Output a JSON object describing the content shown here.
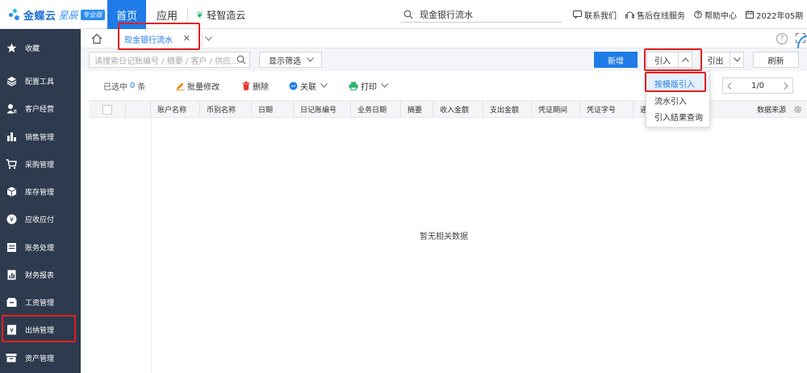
{
  "brand": {
    "name": "金蝶云",
    "sub": "星辰",
    "badge": "专业版",
    "color": "#1f7be8"
  },
  "topnav": {
    "home": "首页",
    "apps": "应用",
    "qz": "轻智造云"
  },
  "global_search": {
    "value": "现金银行流水"
  },
  "top_links": [
    {
      "label": "联系我们",
      "icon": "message-icon"
    },
    {
      "label": "售后在线服务",
      "icon": "headset-icon"
    },
    {
      "label": "帮助中心",
      "icon": "help-icon"
    },
    {
      "label": "2022年05期",
      "icon": "calendar-icon"
    }
  ],
  "sidebar": {
    "items": [
      {
        "label": "收藏",
        "icon": "star-icon"
      },
      {
        "label": "配置工具",
        "icon": "layers-icon"
      },
      {
        "label": "客户经营",
        "icon": "user-icon"
      },
      {
        "label": "销售管理",
        "icon": "bar-chart-icon"
      },
      {
        "label": "采购管理",
        "icon": "cart-icon"
      },
      {
        "label": "库存管理",
        "icon": "box-icon"
      },
      {
        "label": "应收应付",
        "icon": "coin-icon"
      },
      {
        "label": "账务处理",
        "icon": "ledger-icon"
      },
      {
        "label": "财务报表",
        "icon": "report-icon"
      },
      {
        "label": "工资管理",
        "icon": "wallet-icon"
      },
      {
        "label": "出纳管理",
        "icon": "cashier-icon"
      },
      {
        "label": "资产管理",
        "icon": "asset-icon"
      }
    ]
  },
  "tabs": {
    "active": "现金银行流水"
  },
  "filter": {
    "search_placeholder": "请搜索日记账编号 / 摘要 / 客户 / 供应...",
    "show_filter": "显示筛选",
    "new": "新增",
    "import": "引入",
    "export": "引出",
    "refresh": "刷新"
  },
  "toolbar": {
    "selected_prefix": "已选中",
    "selected_count": "0",
    "selected_suffix": "条",
    "batch_edit": "批量修改",
    "delete": "删除",
    "link": "关联",
    "print": "打印"
  },
  "pager": {
    "page": "1/0"
  },
  "table": {
    "columns": [
      "账户名称",
      "币别名称",
      "日期",
      "日记账编号",
      "业务日期",
      "摘要",
      "收入金额",
      "支出金额",
      "凭证期间",
      "凭证字号",
      "通",
      "数据来源"
    ],
    "empty_text": "暂无相关数据"
  },
  "import_menu": {
    "items": [
      "按模版引入",
      "流水引入",
      "引入结果查询"
    ]
  }
}
